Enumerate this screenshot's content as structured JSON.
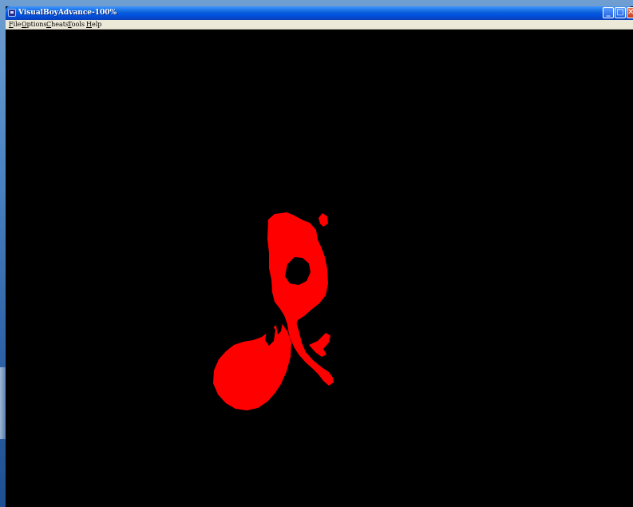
{
  "window": {
    "title": "VisualBoyAdvance-100%",
    "controls": {
      "minimize_glyph": "_",
      "maximize_glyph": "□",
      "close_glyph": "✕"
    }
  },
  "menu": {
    "items": [
      {
        "label": "File",
        "accel": "F",
        "rest": "ile"
      },
      {
        "label": "Options",
        "accel": "O",
        "rest": "ptions"
      },
      {
        "label": "Cheats",
        "accel": "C",
        "rest": "heats"
      },
      {
        "label": "Tools",
        "accel": "T",
        "rest": "ools"
      },
      {
        "label": "Help",
        "accel": "H",
        "rest": "elp"
      }
    ]
  },
  "emulator_screen": {
    "background": "#000000",
    "sprite_color": "#ff0000",
    "sprite_icon": "red-pixel-sprite"
  }
}
